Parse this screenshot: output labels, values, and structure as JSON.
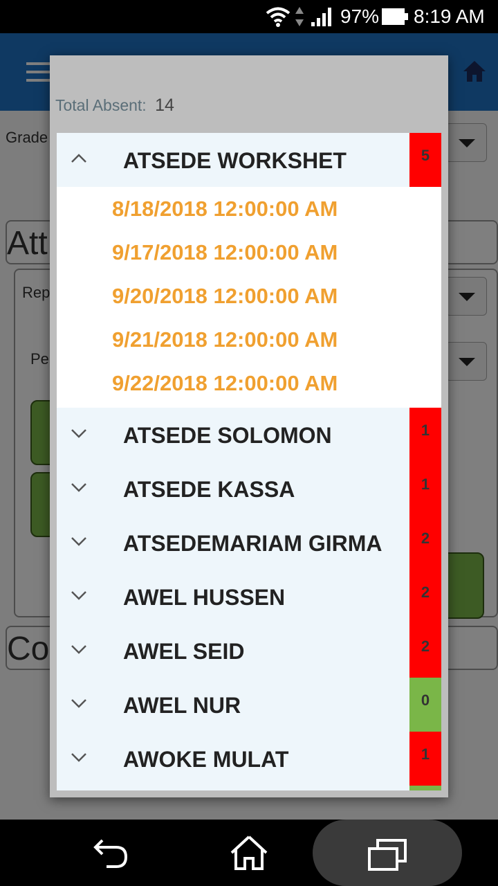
{
  "status_bar": {
    "battery_percent": "97%",
    "time": "8:19 AM",
    "icons": [
      "wifi-icon",
      "data-arrows-icon",
      "signal-icon",
      "battery-icon"
    ]
  },
  "background_app": {
    "grade_label": "Grade",
    "att_partial": "Att",
    "rep_partial": "Rep",
    "pe_partial": "Pe",
    "co_partial": "Co"
  },
  "dialog": {
    "total_absent_label": "Total Absent:",
    "total_absent_value": "14",
    "students": [
      {
        "name": "ATSEDE WORKSHET",
        "count": "5",
        "expanded": true,
        "dates": [
          "8/18/2018 12:00:00 AM",
          "9/17/2018 12:00:00 AM",
          "9/20/2018 12:00:00 AM",
          "9/21/2018 12:00:00 AM",
          "9/22/2018 12:00:00 AM"
        ]
      },
      {
        "name": "ATSEDE SOLOMON",
        "count": "1",
        "expanded": false
      },
      {
        "name": "ATSEDE KASSA",
        "count": "1",
        "expanded": false
      },
      {
        "name": "ATSEDEMARIAM GIRMA",
        "count": "2",
        "expanded": false
      },
      {
        "name": "AWEL HUSSEN",
        "count": "2",
        "expanded": false
      },
      {
        "name": "AWEL SEID",
        "count": "2",
        "expanded": false
      },
      {
        "name": "AWEL NUR",
        "count": "0",
        "expanded": false
      },
      {
        "name": "AWOKE MULAT",
        "count": "1",
        "expanded": false
      }
    ]
  },
  "colors": {
    "app_bar": "#1f73c4",
    "badge_absent": "#ff0000",
    "badge_zero": "#7ab648",
    "date_text": "#f0a030",
    "list_bg": "#eef6fb"
  }
}
